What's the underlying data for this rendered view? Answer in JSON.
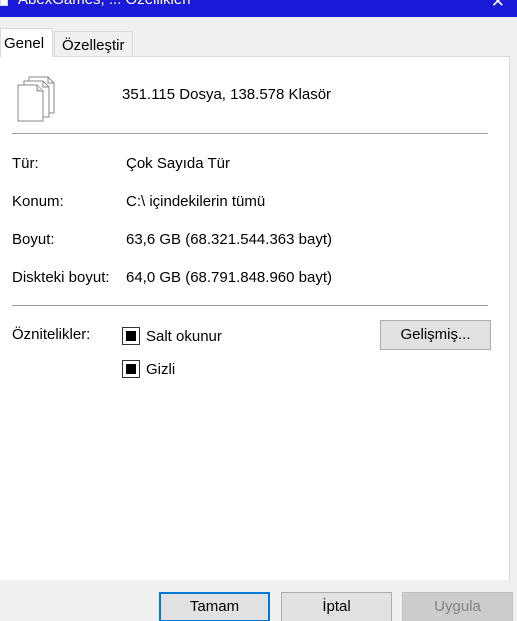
{
  "window": {
    "title": "AbexGames, ... Özellikleri",
    "close_glyph": "✕"
  },
  "tabs": [
    {
      "label": "Genel",
      "selected": true
    },
    {
      "label": "Özelleştir",
      "selected": false
    }
  ],
  "summary": {
    "icon": "files-stack-icon",
    "text": "351.115 Dosya, 138.578 Klasör"
  },
  "properties": [
    {
      "label": "Tür:",
      "value": "Çok Sayıda Tür"
    },
    {
      "label": "Konum:",
      "value": "C:\\ içindekilerin tümü"
    },
    {
      "label": "Boyut:",
      "value": "63,6 GB (68.321.544.363 bayt)"
    },
    {
      "label": "Diskteki boyut:",
      "value": "64,0 GB (68.791.848.960 bayt)"
    }
  ],
  "attributes": {
    "label": "Öznitelikler:",
    "readonly": {
      "label": "Salt okunur",
      "state": "indeterminate"
    },
    "hidden": {
      "label": "Gizli",
      "state": "indeterminate"
    },
    "advanced_button": "Gelişmiş..."
  },
  "buttons": {
    "ok": "Tamam",
    "cancel": "İptal",
    "apply": "Uygula"
  },
  "colors": {
    "titlebar": "#1a1ad8",
    "focus_border": "#0078d7",
    "disabled_text": "#838383"
  }
}
